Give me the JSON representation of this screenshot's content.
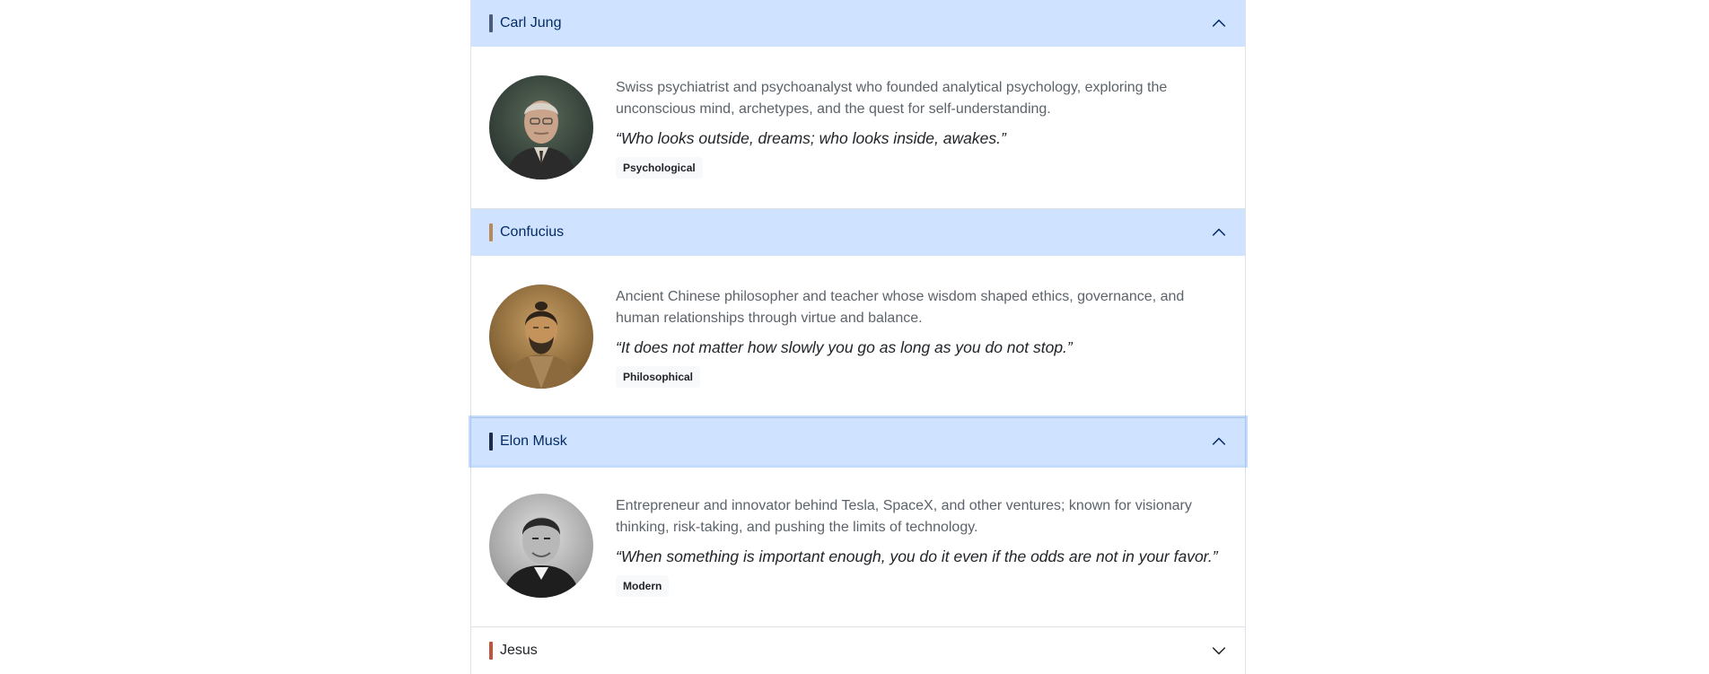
{
  "accordion": {
    "items": [
      {
        "name": "Carl Jung",
        "accent": "#4a5d7a",
        "expanded": true,
        "description": "Swiss psychiatrist and psychoanalyst who founded analytical psychology, exploring the unconscious mind, archetypes, and the quest for self-understanding.",
        "quote": "“Who looks outside, dreams; who looks inside, awakes.”",
        "category": "Psychological",
        "avatar": "carl-jung-portrait"
      },
      {
        "name": "Confucius",
        "accent": "#b88a5a",
        "expanded": true,
        "description": "Ancient Chinese philosopher and teacher whose wisdom shaped ethics, governance, and human relationships through virtue and balance.",
        "quote": "“It does not matter how slowly you go as long as you do not stop.”",
        "category": "Philosophical",
        "avatar": "confucius-portrait"
      },
      {
        "name": "Elon Musk",
        "accent": "#1f2d4a",
        "expanded": true,
        "description": "Entrepreneur and innovator behind Tesla, SpaceX, and other ventures; known for visionary thinking, risk-taking, and pushing the limits of technology.",
        "quote": "“When something is important enough, you do it even if the odds are not in your favor.”",
        "category": "Modern",
        "avatar": "elon-musk-portrait"
      },
      {
        "name": "Jesus",
        "accent": "#c0543c",
        "expanded": false
      }
    ]
  }
}
